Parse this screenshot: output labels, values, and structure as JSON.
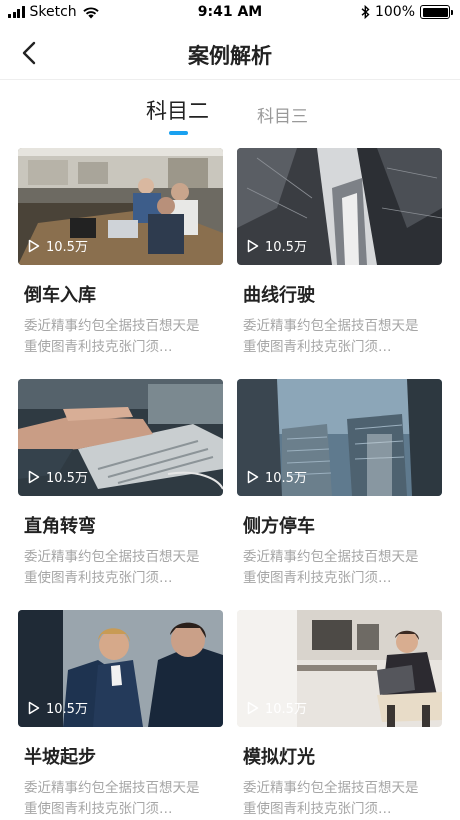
{
  "status_bar": {
    "carrier": "Sketch",
    "time": "9:41 AM",
    "battery": "100%"
  },
  "header": {
    "title": "案例解析"
  },
  "tabs": [
    {
      "label": "科目二",
      "active": true
    },
    {
      "label": "科目三",
      "active": false
    }
  ],
  "accent_color": "#1aa1f0",
  "cards": [
    {
      "title": "倒车入库",
      "views": "10.5万",
      "desc": "委近精事约包全据技百想天是\n重使图青利技克张门须…"
    },
    {
      "title": "曲线行驶",
      "views": "10.5万",
      "desc": "委近精事约包全据技百想天是\n重使图青利技克张门须…"
    },
    {
      "title": "直角转弯",
      "views": "10.5万",
      "desc": "委近精事约包全据技百想天是\n重使图青利技克张门须…"
    },
    {
      "title": "侧方停车",
      "views": "10.5万",
      "desc": "委近精事约包全据技百想天是\n重使图青利技克张门须…"
    },
    {
      "title": "半坡起步",
      "views": "10.5万",
      "desc": "委近精事约包全据技百想天是\n重使图青利技克张门须…"
    },
    {
      "title": "模拟灯光",
      "views": "10.5万",
      "desc": "委近精事约包全据技百想天是\n重使图青利技克张门须…"
    }
  ]
}
